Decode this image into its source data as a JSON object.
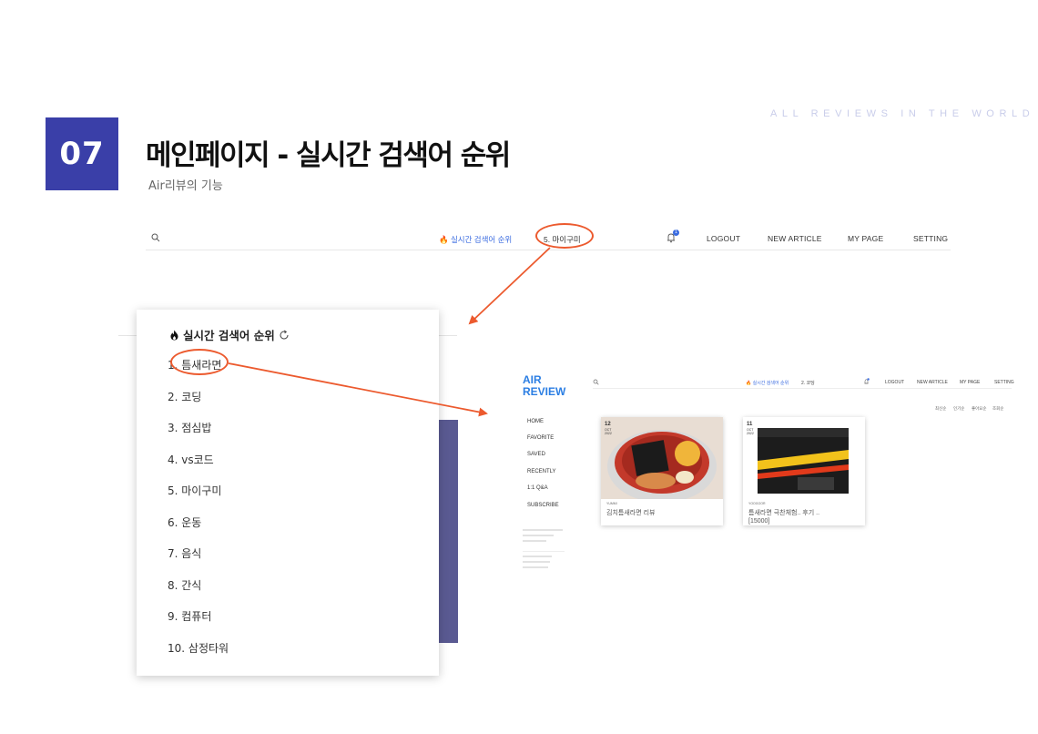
{
  "slide": {
    "number": "07",
    "title": "메인페이지 - 실시간 검색어 순위",
    "subtitle": "Air리뷰의 기능",
    "tagline": "ALL REVIEWS IN THE WORLD"
  },
  "topnav": {
    "trend_label": "🔥 실시간 검색어 순위",
    "current_trend": "5. 마이구미",
    "badge_count": "1",
    "links": [
      "LOGOUT",
      "NEW ARTICLE",
      "MY PAGE",
      "SETTING"
    ]
  },
  "popup": {
    "title": "실시간 검색어 순위",
    "items": [
      "1. 틈새라면",
      "2. 코딩",
      "3. 점심밥",
      "4. vs코드",
      "5. 마이구미",
      "6. 운동",
      "7. 음식",
      "8. 간식",
      "9. 컴퓨터",
      "10. 삼정타워"
    ]
  },
  "preview": {
    "logo_line1": "AIR",
    "logo_line2": "REVIEW",
    "nav_trend": "🔥 실시간 검색어 순위",
    "nav_current": "2. 코딩",
    "nav_links": [
      "LOGOUT",
      "NEW ARTICLE",
      "MY PAGE",
      "SETTING"
    ],
    "sort_options": [
      "최신순",
      "인기순",
      "좋아요순",
      "조회순"
    ],
    "sidebar": [
      "HOME",
      "FAVORITE",
      "SAVED",
      "RECENTLY",
      "1:1 Q&A",
      "SUBSCRIBE"
    ],
    "cards": [
      {
        "day": "12",
        "month": "OCT",
        "year": "2022",
        "author": "YUMMI",
        "title_line1": "김치틈새라면 리뷰",
        "title_line2": ""
      },
      {
        "day": "11",
        "month": "OCT",
        "year": "2022",
        "author": "YOOGOOR",
        "title_line1": "틈새라면 극찬체험.. 후기 ..",
        "title_line2": "[15000]"
      }
    ]
  },
  "colors": {
    "accent": "#3a3fa8",
    "highlight": "#ec5a2e",
    "link_blue": "#3a6be0"
  }
}
